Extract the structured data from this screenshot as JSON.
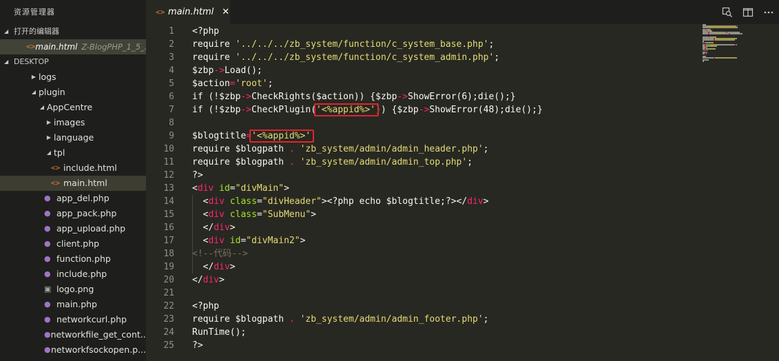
{
  "sidebar": {
    "title": "资源管理器",
    "open_editors_label": "打开的编辑器",
    "open_editor": {
      "name": "main.html",
      "path": "Z-BlogPHP_1_5_..."
    },
    "desktop_label": "DESKTOP",
    "tree": [
      {
        "label": "logs",
        "kind": "folder",
        "expanded": false,
        "depth": 3
      },
      {
        "label": "plugin",
        "kind": "folder",
        "expanded": true,
        "depth": 3
      },
      {
        "label": "AppCentre",
        "kind": "folder",
        "expanded": true,
        "depth": 4
      },
      {
        "label": "images",
        "kind": "folder",
        "expanded": false,
        "depth": 5
      },
      {
        "label": "language",
        "kind": "folder",
        "expanded": false,
        "depth": 5
      },
      {
        "label": "tpl",
        "kind": "folder",
        "expanded": true,
        "depth": 5
      },
      {
        "label": "include.html",
        "kind": "html",
        "depth": 6
      },
      {
        "label": "main.html",
        "kind": "html",
        "depth": 6,
        "selected": true
      },
      {
        "label": "app_del.php",
        "kind": "php",
        "depth": 5
      },
      {
        "label": "app_pack.php",
        "kind": "php",
        "depth": 5
      },
      {
        "label": "app_upload.php",
        "kind": "php",
        "depth": 5
      },
      {
        "label": "client.php",
        "kind": "php",
        "depth": 5
      },
      {
        "label": "function.php",
        "kind": "php",
        "depth": 5
      },
      {
        "label": "include.php",
        "kind": "php",
        "depth": 5
      },
      {
        "label": "logo.png",
        "kind": "png",
        "depth": 5
      },
      {
        "label": "main.php",
        "kind": "php",
        "depth": 5
      },
      {
        "label": "networkcurl.php",
        "kind": "php",
        "depth": 5
      },
      {
        "label": "networkfile_get_cont...",
        "kind": "php",
        "depth": 5
      },
      {
        "label": "networkfsockopen.p...",
        "kind": "php",
        "depth": 5
      }
    ]
  },
  "editor": {
    "tab": {
      "label": "main.html",
      "close_glyph": "✕"
    },
    "actions": [
      "open-preview-icon",
      "split-editor-icon",
      "more-actions-icon"
    ],
    "lines": [
      {
        "n": "1",
        "tokens": [
          [
            "<?php",
            "kw"
          ]
        ]
      },
      {
        "n": "2",
        "tokens": [
          [
            "require ",
            "kw"
          ],
          [
            "'../../../zb_system/function/c_system_base.php'",
            "str"
          ],
          [
            ";",
            "kw"
          ]
        ]
      },
      {
        "n": "3",
        "tokens": [
          [
            "require ",
            "kw"
          ],
          [
            "'../../../zb_system/function/c_system_admin.php'",
            "str"
          ],
          [
            ";",
            "kw"
          ]
        ]
      },
      {
        "n": "4",
        "tokens": [
          [
            "$zbp",
            "kw"
          ],
          [
            "->",
            "op"
          ],
          [
            "Load();",
            "kw"
          ]
        ]
      },
      {
        "n": "5",
        "tokens": [
          [
            "$action",
            "kw"
          ],
          [
            "=",
            "op"
          ],
          [
            "'root'",
            "str"
          ],
          [
            ";",
            "kw"
          ]
        ]
      },
      {
        "n": "6",
        "tokens": [
          [
            "if (!",
            "kw"
          ],
          [
            "$zbp",
            "kw"
          ],
          [
            "->",
            "op"
          ],
          [
            "CheckRights($action)) {",
            "kw"
          ],
          [
            "$zbp",
            "kw"
          ],
          [
            "->",
            "op"
          ],
          [
            "ShowError(6);die();}",
            "kw"
          ]
        ]
      },
      {
        "n": "7",
        "tokens": [
          [
            "if (!",
            "kw"
          ],
          [
            "$zbp",
            "kw"
          ],
          [
            "->",
            "op"
          ],
          [
            "CheckPlugin(",
            "kw"
          ],
          [
            "'<%appid%>'",
            "str"
          ],
          [
            ")) {",
            "kw"
          ],
          [
            "$zbp",
            "kw"
          ],
          [
            "->",
            "op"
          ],
          [
            "ShowError(48);die();}",
            "kw"
          ]
        ]
      },
      {
        "n": "8",
        "tokens": []
      },
      {
        "n": "9",
        "tokens": [
          [
            "$blogtitle",
            "kw"
          ],
          [
            "=",
            "op"
          ],
          [
            "'<%appid%>'",
            "str"
          ]
        ]
      },
      {
        "n": "10",
        "tokens": [
          [
            "require ",
            "kw"
          ],
          [
            "$blogpath ",
            "kw"
          ],
          [
            ". ",
            "op"
          ],
          [
            "'zb_system/admin/admin_header.php'",
            "str"
          ],
          [
            ";",
            "kw"
          ]
        ]
      },
      {
        "n": "11",
        "tokens": [
          [
            "require ",
            "kw"
          ],
          [
            "$blogpath ",
            "kw"
          ],
          [
            ". ",
            "op"
          ],
          [
            "'zb_system/admin/admin_top.php'",
            "str"
          ],
          [
            ";",
            "kw"
          ]
        ]
      },
      {
        "n": "12",
        "tokens": [
          [
            "?>",
            "kw"
          ]
        ]
      },
      {
        "n": "13",
        "tokens": [
          [
            "<",
            "kw"
          ],
          [
            "div",
            "tag"
          ],
          [
            " ",
            "kw"
          ],
          [
            "id",
            "attr"
          ],
          [
            "=",
            "kw"
          ],
          [
            "\"divMain\"",
            "str"
          ],
          [
            ">",
            "kw"
          ]
        ]
      },
      {
        "n": "14",
        "tokens": [
          [
            "  <",
            "kw"
          ],
          [
            "div",
            "tag"
          ],
          [
            " ",
            "kw"
          ],
          [
            "class",
            "attr"
          ],
          [
            "=",
            "kw"
          ],
          [
            "\"divHeader\"",
            "str"
          ],
          [
            "><?php echo $blogtitle;?></",
            "kw"
          ],
          [
            "div",
            "tag"
          ],
          [
            ">",
            "kw"
          ]
        ]
      },
      {
        "n": "15",
        "tokens": [
          [
            "  <",
            "kw"
          ],
          [
            "div",
            "tag"
          ],
          [
            " ",
            "kw"
          ],
          [
            "class",
            "attr"
          ],
          [
            "=",
            "kw"
          ],
          [
            "\"SubMenu\"",
            "str"
          ],
          [
            ">",
            "kw"
          ]
        ]
      },
      {
        "n": "16",
        "tokens": [
          [
            "  </",
            "kw"
          ],
          [
            "div",
            "tag"
          ],
          [
            ">",
            "kw"
          ]
        ]
      },
      {
        "n": "17",
        "tokens": [
          [
            "  <",
            "kw"
          ],
          [
            "div",
            "tag"
          ],
          [
            " ",
            "kw"
          ],
          [
            "id",
            "attr"
          ],
          [
            "=",
            "kw"
          ],
          [
            "\"divMain2\"",
            "str"
          ],
          [
            ">",
            "kw"
          ]
        ]
      },
      {
        "n": "18",
        "tokens": [
          [
            "<!--代码-->",
            "cmt"
          ]
        ]
      },
      {
        "n": "19",
        "tokens": [
          [
            "  </",
            "kw"
          ],
          [
            "div",
            "tag"
          ],
          [
            ">",
            "kw"
          ]
        ]
      },
      {
        "n": "20",
        "tokens": [
          [
            "</",
            "kw"
          ],
          [
            "div",
            "tag"
          ],
          [
            ">",
            "kw"
          ]
        ]
      },
      {
        "n": "21",
        "tokens": []
      },
      {
        "n": "22",
        "tokens": [
          [
            "<?php",
            "kw"
          ]
        ]
      },
      {
        "n": "23",
        "tokens": [
          [
            "require ",
            "kw"
          ],
          [
            "$blogpath ",
            "kw"
          ],
          [
            ". ",
            "op"
          ],
          [
            "'zb_system/admin/admin_footer.php'",
            "str"
          ],
          [
            ";",
            "kw"
          ]
        ]
      },
      {
        "n": "24",
        "tokens": [
          [
            "RunTime();",
            "kw"
          ]
        ]
      },
      {
        "n": "25",
        "tokens": [
          [
            "?>",
            "kw"
          ]
        ]
      }
    ]
  },
  "colors": {
    "highlight_box": "#e3232a",
    "background": "#272822",
    "sidebar": "#1e1f1c"
  }
}
